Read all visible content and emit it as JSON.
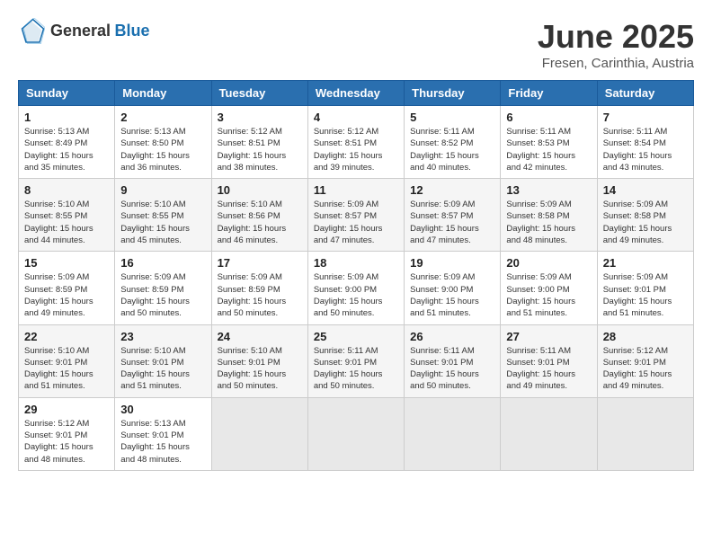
{
  "header": {
    "logo_general": "General",
    "logo_blue": "Blue",
    "month": "June 2025",
    "location": "Fresen, Carinthia, Austria"
  },
  "days_of_week": [
    "Sunday",
    "Monday",
    "Tuesday",
    "Wednesday",
    "Thursday",
    "Friday",
    "Saturday"
  ],
  "weeks": [
    [
      {
        "day": "1",
        "sunrise": "5:13 AM",
        "sunset": "8:49 PM",
        "daylight": "15 hours and 35 minutes."
      },
      {
        "day": "2",
        "sunrise": "5:13 AM",
        "sunset": "8:50 PM",
        "daylight": "15 hours and 36 minutes."
      },
      {
        "day": "3",
        "sunrise": "5:12 AM",
        "sunset": "8:51 PM",
        "daylight": "15 hours and 38 minutes."
      },
      {
        "day": "4",
        "sunrise": "5:12 AM",
        "sunset": "8:51 PM",
        "daylight": "15 hours and 39 minutes."
      },
      {
        "day": "5",
        "sunrise": "5:11 AM",
        "sunset": "8:52 PM",
        "daylight": "15 hours and 40 minutes."
      },
      {
        "day": "6",
        "sunrise": "5:11 AM",
        "sunset": "8:53 PM",
        "daylight": "15 hours and 42 minutes."
      },
      {
        "day": "7",
        "sunrise": "5:11 AM",
        "sunset": "8:54 PM",
        "daylight": "15 hours and 43 minutes."
      }
    ],
    [
      {
        "day": "8",
        "sunrise": "5:10 AM",
        "sunset": "8:55 PM",
        "daylight": "15 hours and 44 minutes."
      },
      {
        "day": "9",
        "sunrise": "5:10 AM",
        "sunset": "8:55 PM",
        "daylight": "15 hours and 45 minutes."
      },
      {
        "day": "10",
        "sunrise": "5:10 AM",
        "sunset": "8:56 PM",
        "daylight": "15 hours and 46 minutes."
      },
      {
        "day": "11",
        "sunrise": "5:09 AM",
        "sunset": "8:57 PM",
        "daylight": "15 hours and 47 minutes."
      },
      {
        "day": "12",
        "sunrise": "5:09 AM",
        "sunset": "8:57 PM",
        "daylight": "15 hours and 47 minutes."
      },
      {
        "day": "13",
        "sunrise": "5:09 AM",
        "sunset": "8:58 PM",
        "daylight": "15 hours and 48 minutes."
      },
      {
        "day": "14",
        "sunrise": "5:09 AM",
        "sunset": "8:58 PM",
        "daylight": "15 hours and 49 minutes."
      }
    ],
    [
      {
        "day": "15",
        "sunrise": "5:09 AM",
        "sunset": "8:59 PM",
        "daylight": "15 hours and 49 minutes."
      },
      {
        "day": "16",
        "sunrise": "5:09 AM",
        "sunset": "8:59 PM",
        "daylight": "15 hours and 50 minutes."
      },
      {
        "day": "17",
        "sunrise": "5:09 AM",
        "sunset": "8:59 PM",
        "daylight": "15 hours and 50 minutes."
      },
      {
        "day": "18",
        "sunrise": "5:09 AM",
        "sunset": "9:00 PM",
        "daylight": "15 hours and 50 minutes."
      },
      {
        "day": "19",
        "sunrise": "5:09 AM",
        "sunset": "9:00 PM",
        "daylight": "15 hours and 51 minutes."
      },
      {
        "day": "20",
        "sunrise": "5:09 AM",
        "sunset": "9:00 PM",
        "daylight": "15 hours and 51 minutes."
      },
      {
        "day": "21",
        "sunrise": "5:09 AM",
        "sunset": "9:01 PM",
        "daylight": "15 hours and 51 minutes."
      }
    ],
    [
      {
        "day": "22",
        "sunrise": "5:10 AM",
        "sunset": "9:01 PM",
        "daylight": "15 hours and 51 minutes."
      },
      {
        "day": "23",
        "sunrise": "5:10 AM",
        "sunset": "9:01 PM",
        "daylight": "15 hours and 51 minutes."
      },
      {
        "day": "24",
        "sunrise": "5:10 AM",
        "sunset": "9:01 PM",
        "daylight": "15 hours and 50 minutes."
      },
      {
        "day": "25",
        "sunrise": "5:11 AM",
        "sunset": "9:01 PM",
        "daylight": "15 hours and 50 minutes."
      },
      {
        "day": "26",
        "sunrise": "5:11 AM",
        "sunset": "9:01 PM",
        "daylight": "15 hours and 50 minutes."
      },
      {
        "day": "27",
        "sunrise": "5:11 AM",
        "sunset": "9:01 PM",
        "daylight": "15 hours and 49 minutes."
      },
      {
        "day": "28",
        "sunrise": "5:12 AM",
        "sunset": "9:01 PM",
        "daylight": "15 hours and 49 minutes."
      }
    ],
    [
      {
        "day": "29",
        "sunrise": "5:12 AM",
        "sunset": "9:01 PM",
        "daylight": "15 hours and 48 minutes."
      },
      {
        "day": "30",
        "sunrise": "5:13 AM",
        "sunset": "9:01 PM",
        "daylight": "15 hours and 48 minutes."
      },
      null,
      null,
      null,
      null,
      null
    ]
  ]
}
